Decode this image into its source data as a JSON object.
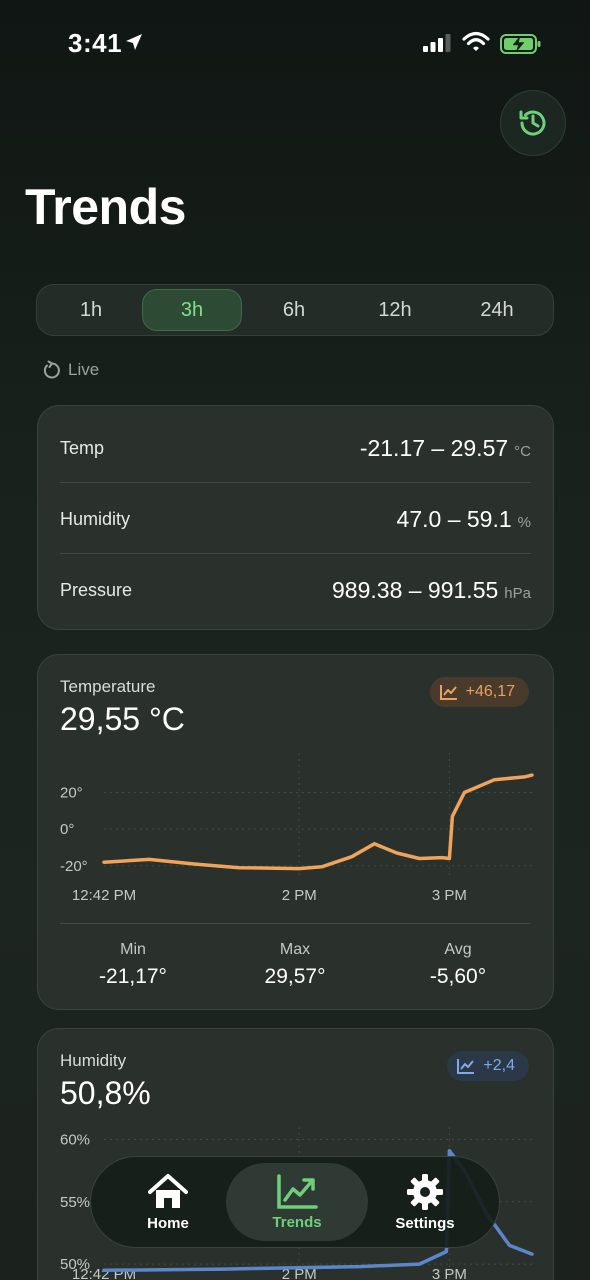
{
  "status": {
    "time": "3:41"
  },
  "page": {
    "title": "Trends"
  },
  "range_selector": {
    "options": [
      "1h",
      "3h",
      "6h",
      "12h",
      "24h"
    ],
    "selected": "3h"
  },
  "live": {
    "label": "Live"
  },
  "ranges": [
    {
      "label": "Temp",
      "value": "-21.17 – 29.57",
      "unit": "°C"
    },
    {
      "label": "Humidity",
      "value": "47.0 – 59.1",
      "unit": "%"
    },
    {
      "label": "Pressure",
      "value": "989.38 – 991.55",
      "unit": "hPa"
    }
  ],
  "temperature": {
    "label": "Temperature",
    "value": "29,55 °C",
    "delta": "+46,17",
    "stats": [
      {
        "label": "Min",
        "value": "-21,17°"
      },
      {
        "label": "Max",
        "value": "29,57°"
      },
      {
        "label": "Avg",
        "value": "-5,60°"
      }
    ]
  },
  "humidity": {
    "label": "Humidity",
    "value": "50,8%",
    "delta": "+2,4"
  },
  "chart_data": [
    {
      "type": "line",
      "title": "Temperature",
      "y_ticks": [
        "20°",
        "0°",
        "-20°"
      ],
      "x_ticks": [
        "12:42 PM",
        "2 PM",
        "3 PM"
      ],
      "ylim": [
        -25,
        35
      ],
      "x_hours": [
        12.7,
        13.0,
        13.3,
        13.6,
        14.0,
        14.15,
        14.35,
        14.5,
        14.65,
        14.8,
        14.95,
        15.0,
        15.02,
        15.1,
        15.3,
        15.5,
        15.55
      ],
      "values": [
        -18,
        -16.5,
        -19,
        -21,
        -21.5,
        -20.5,
        -15,
        -8,
        -13,
        -16,
        -15.5,
        -16,
        7,
        20,
        27,
        28.5,
        29.5
      ],
      "color": "#f0a35a",
      "grid": true
    },
    {
      "type": "line",
      "title": "Humidity",
      "y_ticks": [
        "60%",
        "55%",
        "50%"
      ],
      "x_ticks": [
        "12:42 PM",
        "2 PM",
        "3 PM"
      ],
      "ylim": [
        48,
        61
      ],
      "x_hours": [
        12.7,
        13.5,
        14.4,
        14.8,
        14.98,
        15.0,
        15.1,
        15.25,
        15.4,
        15.55
      ],
      "values": [
        49.5,
        49.6,
        49.8,
        50.0,
        51.0,
        59.1,
        57.5,
        54.0,
        51.5,
        50.8
      ],
      "color": "#5b86c9",
      "grid": true
    }
  ],
  "tabs": [
    {
      "label": "Home",
      "icon": "home-icon"
    },
    {
      "label": "Trends",
      "icon": "trends-icon"
    },
    {
      "label": "Settings",
      "icon": "settings-icon"
    }
  ],
  "colors": {
    "accent_green": "#6fd07a",
    "temp_orange": "#f0a35a",
    "humidity_blue": "#5b86c9"
  }
}
